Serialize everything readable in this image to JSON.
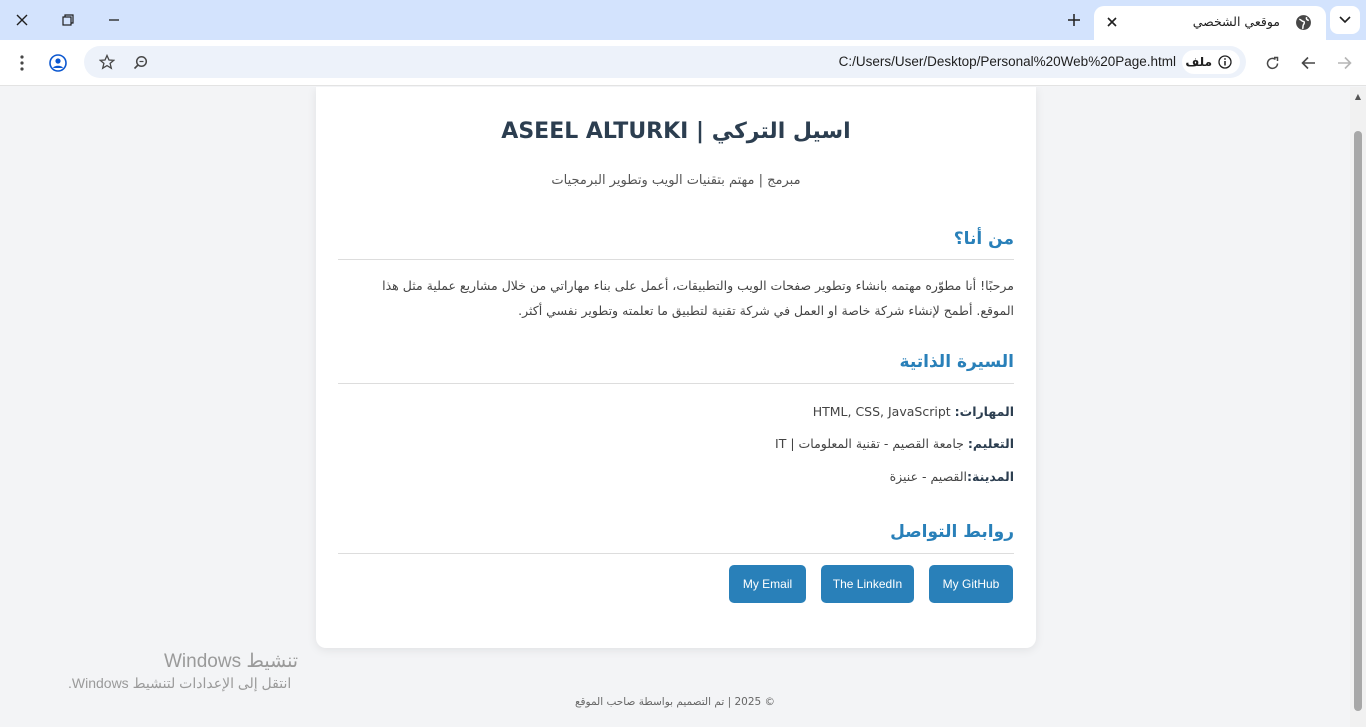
{
  "browser": {
    "tab_title": "موقعي الشخصي",
    "url": "C:/Users/User/Desktop/Personal%20Web%20Page.html",
    "chip_label": "ملف"
  },
  "page": {
    "name": "اسيل التركي | ASEEL ALTURKI",
    "subtitle": "مبرمج | مهتم بتقنيات الويب وتطوير البرمجيات",
    "about": {
      "heading": "من أنا؟",
      "text": "مرحبًا! أنا مطوّره مهتمه بانشاء وتطوير صفحات الويب والتطبيقات، أعمل على بناء مهاراتي من خلال مشاريع عملية مثل هذا الموقع. أطمح لإنشاء شركة خاصة او العمل في شركة تقنية لتطبيق ما تعلمته وتطوير نفسي أكثر."
    },
    "cv": {
      "heading": "السيرة الذاتية",
      "skills_label": "المهارات:",
      "skills_value": " HTML, CSS, JavaScript",
      "education_label": "التعليم:",
      "education_value": " جامعة القصيم - تقنية المعلومات | IT",
      "city_label": "المدينة:",
      "city_value": "القصيم - عنيزة"
    },
    "links": {
      "heading": "روابط التواصل",
      "github": "My GitHub",
      "linkedin": "The LinkedIn",
      "email": "My Email"
    },
    "footer": "© 2025 | تم التصميم بواسطة صاحب الموقع"
  },
  "watermark": {
    "line1": "تنشيط Windows",
    "line2": "انتقل إلى الإعدادات لتنشيط Windows."
  },
  "colors": {
    "accent": "#2980b9",
    "heading": "#2c3e50",
    "tabbar": "#d3e3fd"
  }
}
